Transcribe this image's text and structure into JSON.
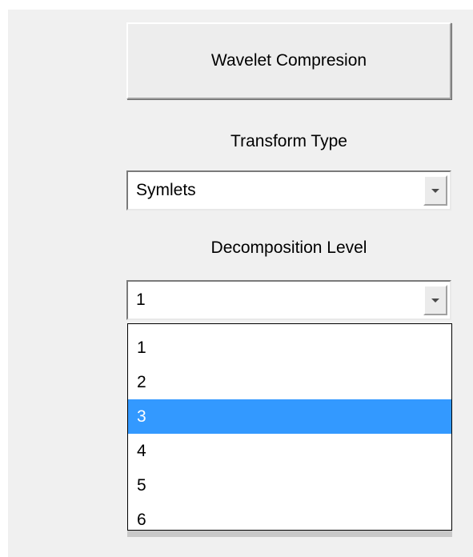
{
  "compress_button": {
    "label": "Wavelet Compresion"
  },
  "transform_type": {
    "label": "Transform Type",
    "selected": "Symlets"
  },
  "decomposition_level": {
    "label": "Decomposition Level",
    "selected": "1",
    "options": [
      "1",
      "2",
      "3",
      "4",
      "5",
      "6"
    ],
    "highlighted": "3"
  },
  "colors": {
    "highlight": "#3399ff",
    "panel_bg": "#f0f0f0"
  }
}
